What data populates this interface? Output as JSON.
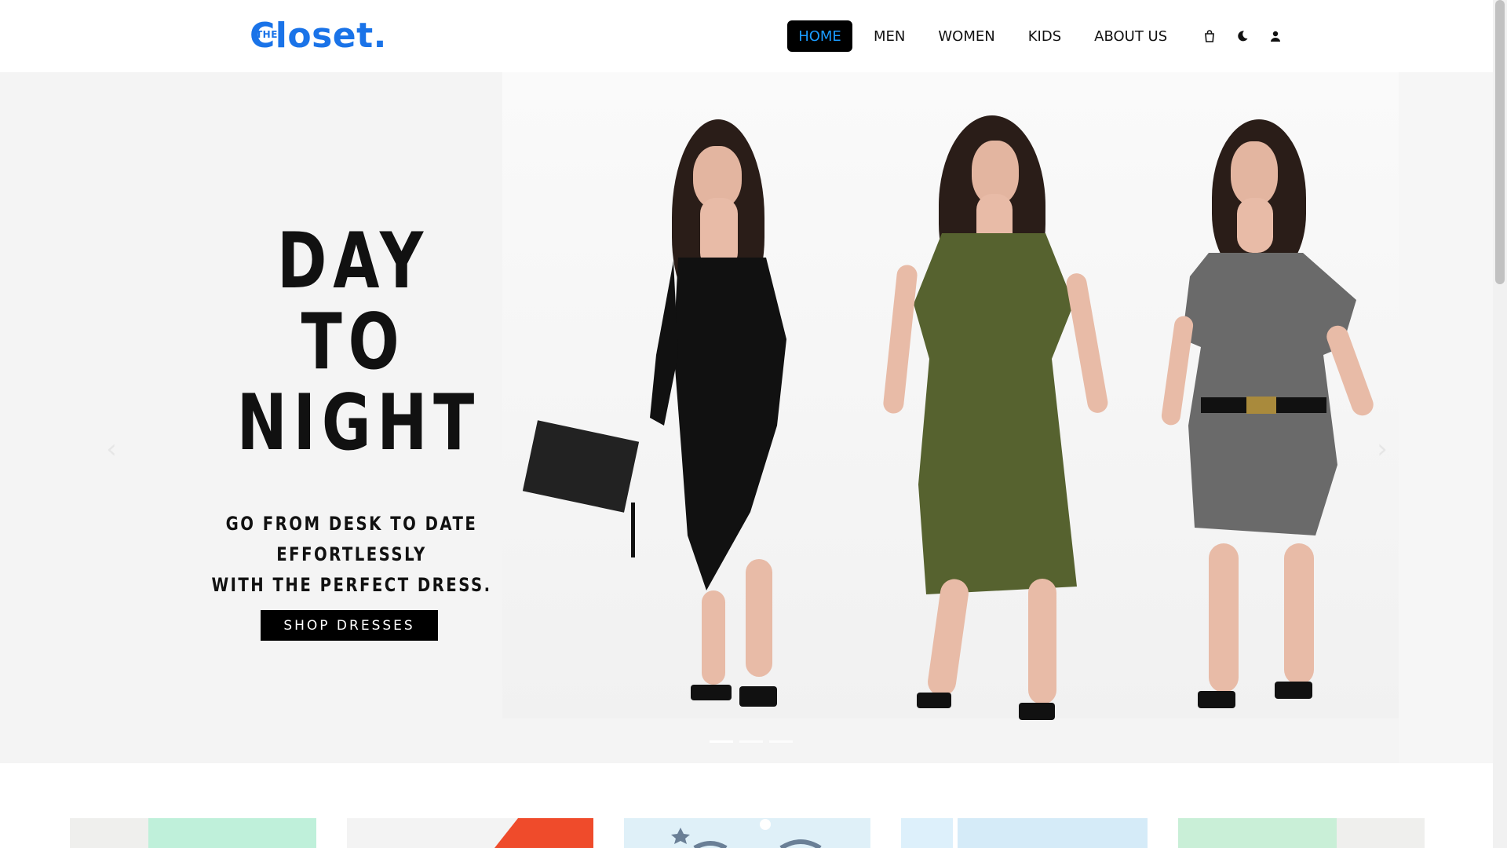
{
  "header": {
    "logo": {
      "small": "THE",
      "word": "Closet."
    },
    "nav": [
      {
        "label": "HOME",
        "active": true
      },
      {
        "label": "MEN",
        "active": false
      },
      {
        "label": "WOMEN",
        "active": false
      },
      {
        "label": "KIDS",
        "active": false
      },
      {
        "label": "ABOUT US",
        "active": false
      }
    ],
    "icons": [
      "shopping-bag-icon",
      "moon-icon",
      "user-icon"
    ]
  },
  "hero": {
    "title_lines": [
      "DAY",
      "TO",
      "NIGHT"
    ],
    "subtitle_lines": [
      "GO FROM DESK TO DATE EFFORTLESSLY",
      "WITH THE PERFECT DRESS."
    ],
    "button": "SHOP DRESSES",
    "prev_arrow": "‹",
    "next_arrow": "›",
    "slides": 3,
    "active_slide": 0,
    "dress_colors": [
      "#111111",
      "#56622f",
      "#6a6a6a"
    ]
  },
  "cards": {
    "colors": [
      [
        "#efefed",
        "#bff0da"
      ],
      [
        "#f3f3f3",
        "#ef4b2b"
      ],
      [
        "#dff0f8",
        "#dff0f8"
      ],
      [
        "#ddf0fb",
        "#d5ebf8"
      ],
      [
        "#c9efd7",
        "#efefed"
      ]
    ]
  },
  "theme": {
    "brand": "#1a73e8",
    "nav_active_bg": "#000000",
    "nav_active_text": "#1a9bff"
  }
}
